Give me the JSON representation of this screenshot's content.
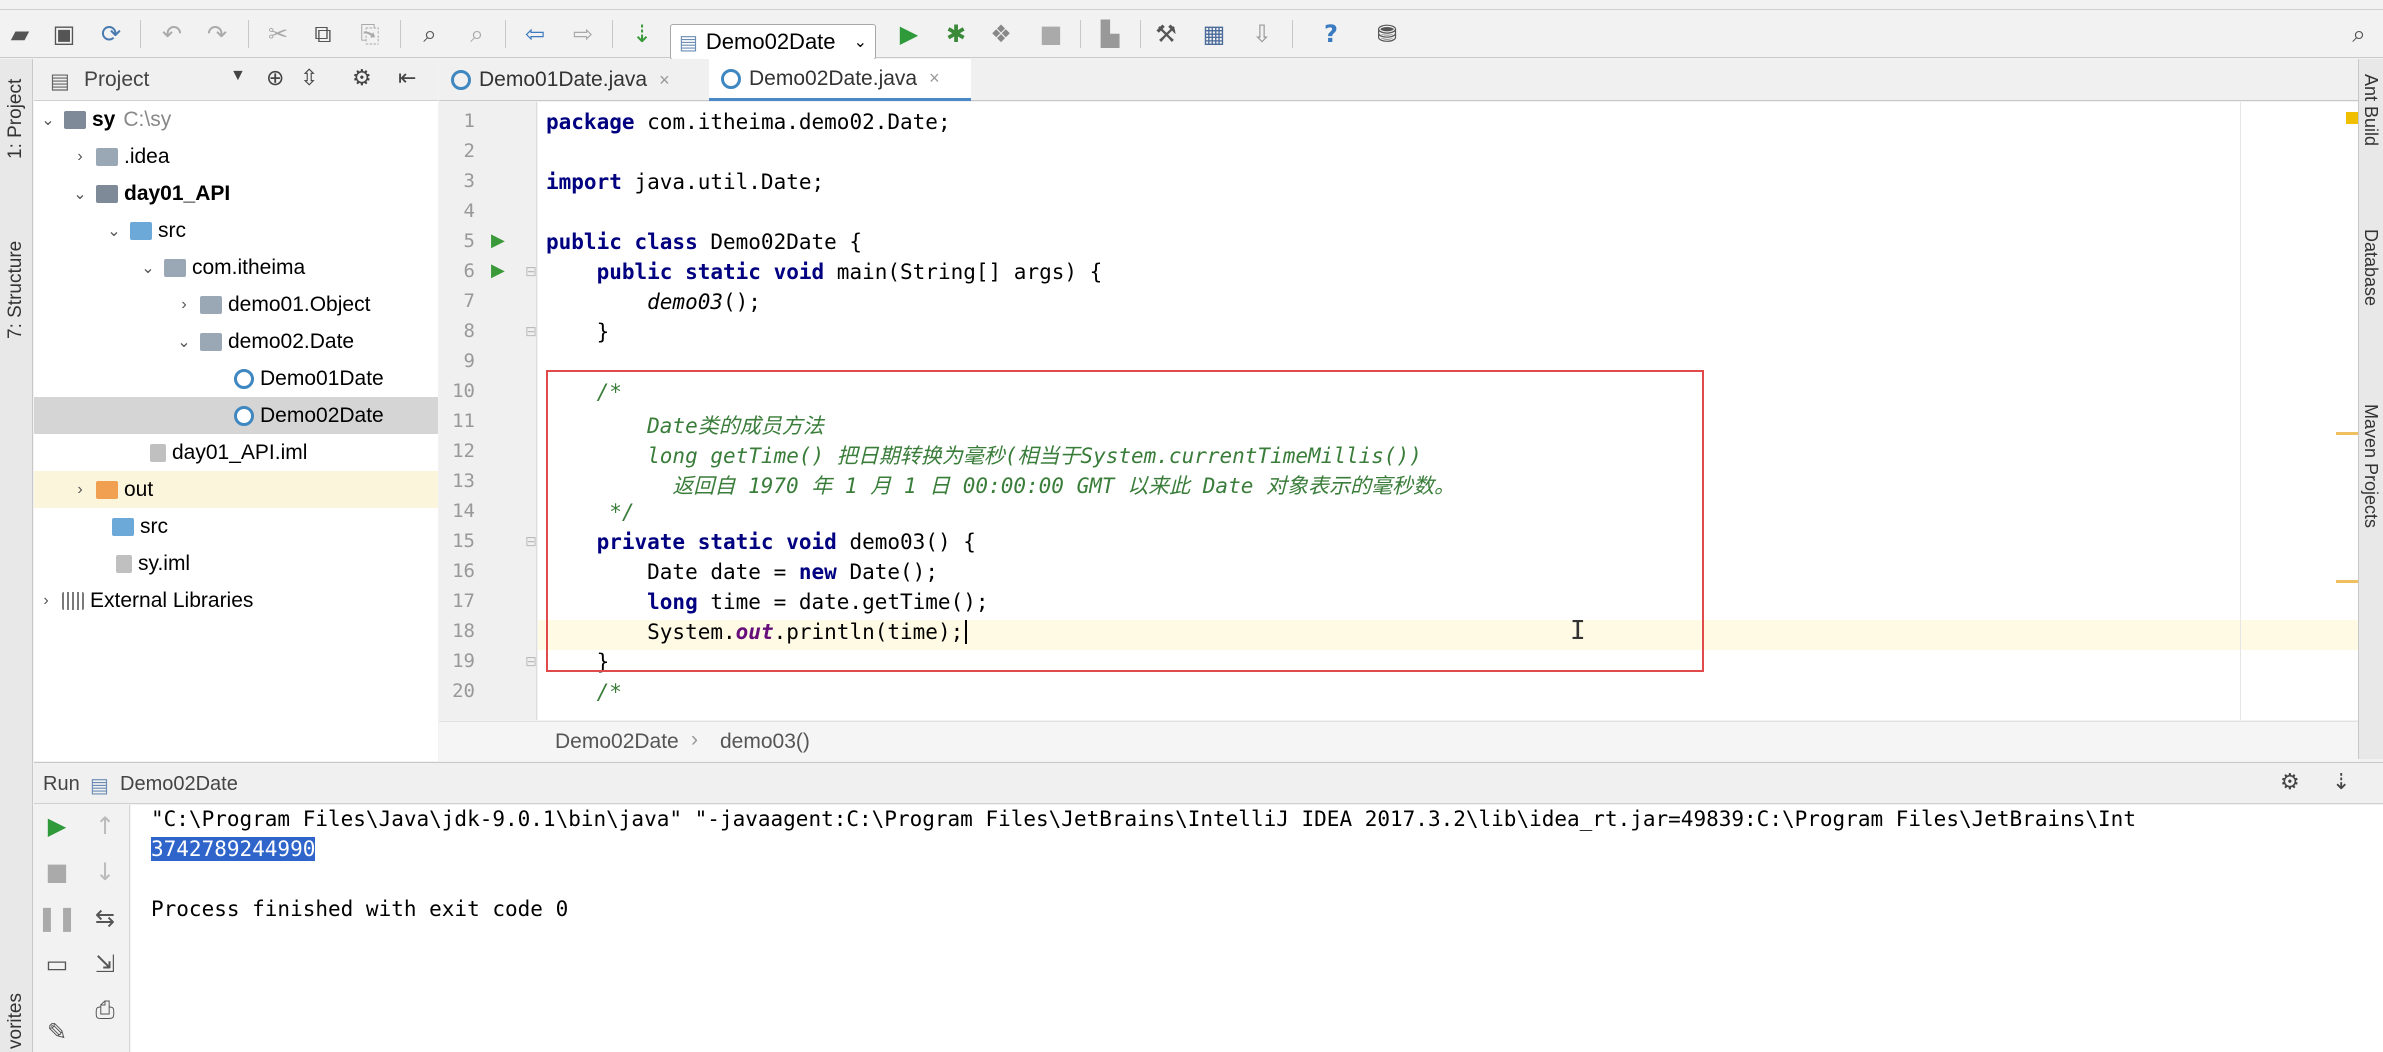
{
  "toolbar": {
    "run_config": "Demo02Date",
    "icons": [
      "open-icon",
      "save-icon",
      "sync-icon",
      "undo-icon",
      "redo-icon",
      "cut-icon",
      "copy-icon",
      "paste-icon",
      "find-icon",
      "replace-icon",
      "back-icon",
      "forward-icon",
      "build-icon",
      "run-config-dropdown",
      "run-icon",
      "debug-icon",
      "coverage-icon",
      "stop-icon",
      "project-structure-icon",
      "settings-icon",
      "sdk-icon",
      "vcs-icon",
      "help-icon",
      "plugin-icon"
    ],
    "help": "?"
  },
  "left_strip": {
    "project": "1: Project",
    "structure": "7: Structure",
    "favorites": "vorites"
  },
  "right_strip": {
    "ant": "Ant Build",
    "database": "Database",
    "maven": "Maven Projects"
  },
  "project_panel": {
    "title": "Project",
    "tree": [
      {
        "label": "sy",
        "extra": "C:\\sy",
        "bold": true,
        "expanded": true
      },
      {
        "label": ".idea"
      },
      {
        "label": "day01_API",
        "bold": true
      },
      {
        "label": "src"
      },
      {
        "label": "com.itheima"
      },
      {
        "label": "demo01.Object"
      },
      {
        "label": "demo02.Date"
      },
      {
        "label": "Demo01Date"
      },
      {
        "label": "Demo02Date"
      },
      {
        "label": "day01_API.iml"
      },
      {
        "label": "out"
      },
      {
        "label": "src"
      },
      {
        "label": "sy.iml"
      },
      {
        "label": "External Libraries"
      }
    ]
  },
  "editor": {
    "tabs": [
      {
        "label": "Demo01Date.java",
        "close": "×"
      },
      {
        "label": "Demo02Date.java",
        "close": "×"
      }
    ],
    "line_numbers": [
      "1",
      "2",
      "3",
      "4",
      "5",
      "6",
      "7",
      "8",
      "9",
      "10",
      "11",
      "12",
      "13",
      "14",
      "15",
      "16",
      "17",
      "18",
      "19",
      "20"
    ],
    "lines": {
      "l1a": "package",
      "l1b": " com.itheima.demo02.Date;",
      "l3a": "import",
      "l3b": " java.util.Date;",
      "l5a": "public class",
      "l5b": " Demo02Date {",
      "l6a": "    public static void",
      "l6b": " main(String[] args) {",
      "l7": "        demo03",
      "l7b": "();",
      "l8": "    }",
      "l10": "    /*",
      "l11": "        Date类的成员方法",
      "l12": "        long getTime() 把日期转换为毫秒(相当于System.currentTimeMillis())",
      "l13": "          返回自 1970 年 1 月 1 日 00:00:00 GMT 以来此 Date 对象表示的毫秒数。",
      "l14": "     */",
      "l15a": "    private static void",
      "l15b": " demo03() {",
      "l16a": "        Date date = ",
      "l16b": "new",
      "l16c": " Date();",
      "l17a": "        long",
      "l17b": " time = date.getTime();",
      "l18a": "        System.",
      "l18b": "out",
      "l18c": ".println(time);",
      "l19": "    }",
      "l20": "    /*"
    }
  },
  "breadcrumb": {
    "items": [
      "Demo02Date",
      "demo03()"
    ],
    "sep": "›"
  },
  "run_panel": {
    "title": "Run",
    "config": "Demo02Date",
    "console": [
      "\"C:\\Program Files\\Java\\jdk-9.0.1\\bin\\java\" \"-javaagent:C:\\Program Files\\JetBrains\\IntelliJ IDEA 2017.3.2\\lib\\idea_rt.jar=49839:C:\\Program Files\\JetBrains\\Int",
      "3742789244990",
      "",
      "Process finished with exit code 0"
    ]
  }
}
